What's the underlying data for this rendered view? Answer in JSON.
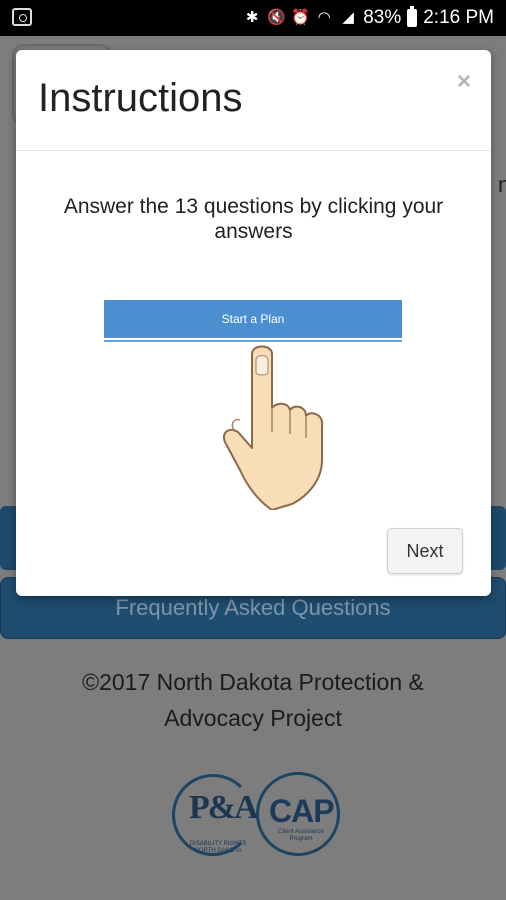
{
  "status_bar": {
    "battery": "83%",
    "time": "2:16 PM",
    "icons": [
      "bluetooth-icon",
      "mute-icon",
      "alarm-icon",
      "wifi-icon",
      "signal-icon",
      "battery-icon"
    ]
  },
  "background": {
    "faq_label": "Frequently Asked Questions",
    "copyright": "©2017 North Dakota Protection & Advocacy Project",
    "right_edge_char": "n",
    "logos": {
      "pa": {
        "text": "P&A",
        "sub": "DISABILITY RIGHTS NORTH DAKOTA"
      },
      "cap": {
        "text": "CAP",
        "sub": "Client Assistance Program"
      }
    }
  },
  "modal": {
    "title": "Instructions",
    "close": "×",
    "instruction": "Answer the 13 questions by clicking your answers",
    "demo_button": "Start a Plan",
    "next": "Next"
  }
}
